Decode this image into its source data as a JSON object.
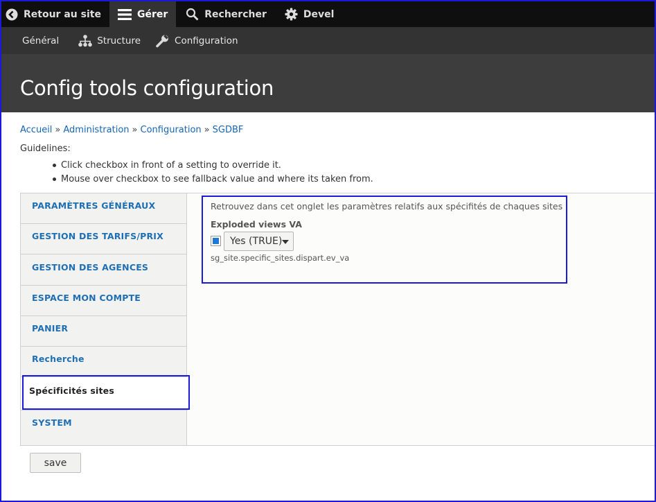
{
  "toolbar": {
    "back_label": "Retour au site",
    "manage_label": "Gérer",
    "search_label": "Rechercher",
    "devel_label": "Devel"
  },
  "subtoolbar": {
    "general_label": "Général",
    "structure_label": "Structure",
    "configuration_label": "Configuration"
  },
  "page": {
    "title": "Config tools configuration"
  },
  "breadcrumb": {
    "items": [
      "Accueil",
      "Administration",
      "Configuration",
      "SGDBF"
    ],
    "separator": "»"
  },
  "guidelines": {
    "label": "Guidelines:",
    "items": [
      "Click checkbox in front of a setting to override it.",
      "Mouse over checkbox to see fallback value and where its taken from."
    ]
  },
  "tabs": [
    {
      "label": "PARAMÈTRES GÉNÉRAUX",
      "active": false
    },
    {
      "label": "GESTION DES TARIFS/PRIX",
      "active": false
    },
    {
      "label": "GESTION DES AGENCES",
      "active": false
    },
    {
      "label": "ESPACE MON COMPTE",
      "active": false
    },
    {
      "label": "PANIER",
      "active": false
    },
    {
      "label": "Recherche",
      "active": false
    },
    {
      "label": "Spécificités sites",
      "active": true
    },
    {
      "label": "SYSTEM",
      "active": false
    }
  ],
  "pane": {
    "description": "Retrouvez dans cet onglet les paramètres relatifs aux spécifités de chaques sites",
    "field_label": "Exploded views VA",
    "override_checked": true,
    "select_value": "Yes (TRUE)",
    "field_key": "sg_site.specific_sites.dispart.ev_va"
  },
  "form": {
    "save_label": "save"
  },
  "colors": {
    "toolbar_bg": "#0f0f0f",
    "subtoolbar_bg": "#333333",
    "header_bg": "#3d3d3d",
    "link": "#1565b6",
    "annotation_border": "#1a1adc",
    "checkbox_fill": "#1e7bd1"
  }
}
